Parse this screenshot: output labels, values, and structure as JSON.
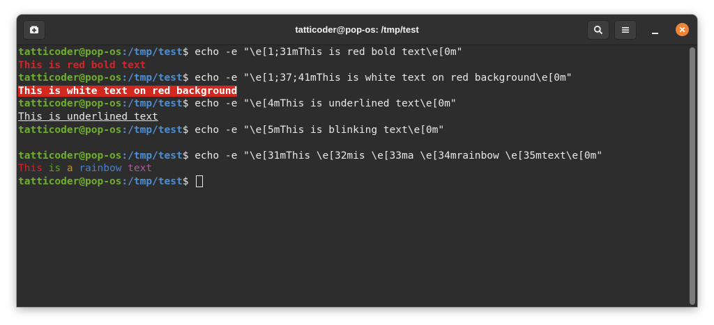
{
  "window": {
    "title": "tatticoder@pop-os: /tmp/test"
  },
  "prompt": {
    "user_host": "tatticoder@pop-os",
    "path": ":/tmp/test",
    "symbol": "$ "
  },
  "lines": {
    "l1_cmd": "echo -e \"\\e[1;31mThis is red bold text\\e[0m\"",
    "l2_out": "This is red bold text",
    "l3_cmd": "echo -e \"\\e[1;37;41mThis is white text on red background\\e[0m\"",
    "l4_out": "This is white text on red background",
    "l5_cmd": "echo -e \"\\e[4mThis is underlined text\\e[0m\"",
    "l6_out": "This is underlined text",
    "l7_cmd": "echo -e \"\\e[5mThis is blinking text\\e[0m\"",
    "l9_cmd": "echo -e \"\\e[31mThis \\e[32mis \\e[33ma \\e[34mrainbow \\e[35mtext\\e[0m\"",
    "rainbow": [
      "This ",
      "is ",
      "a ",
      "rainbow ",
      "text"
    ]
  },
  "colors": {
    "prompt_user": "#6fae2e",
    "prompt_path": "#4e8fd4",
    "red": "#d3252a",
    "close_button": "#f08437"
  },
  "icons": [
    "new-tab-icon",
    "search-icon",
    "menu-icon",
    "minimize-icon",
    "close-icon"
  ]
}
